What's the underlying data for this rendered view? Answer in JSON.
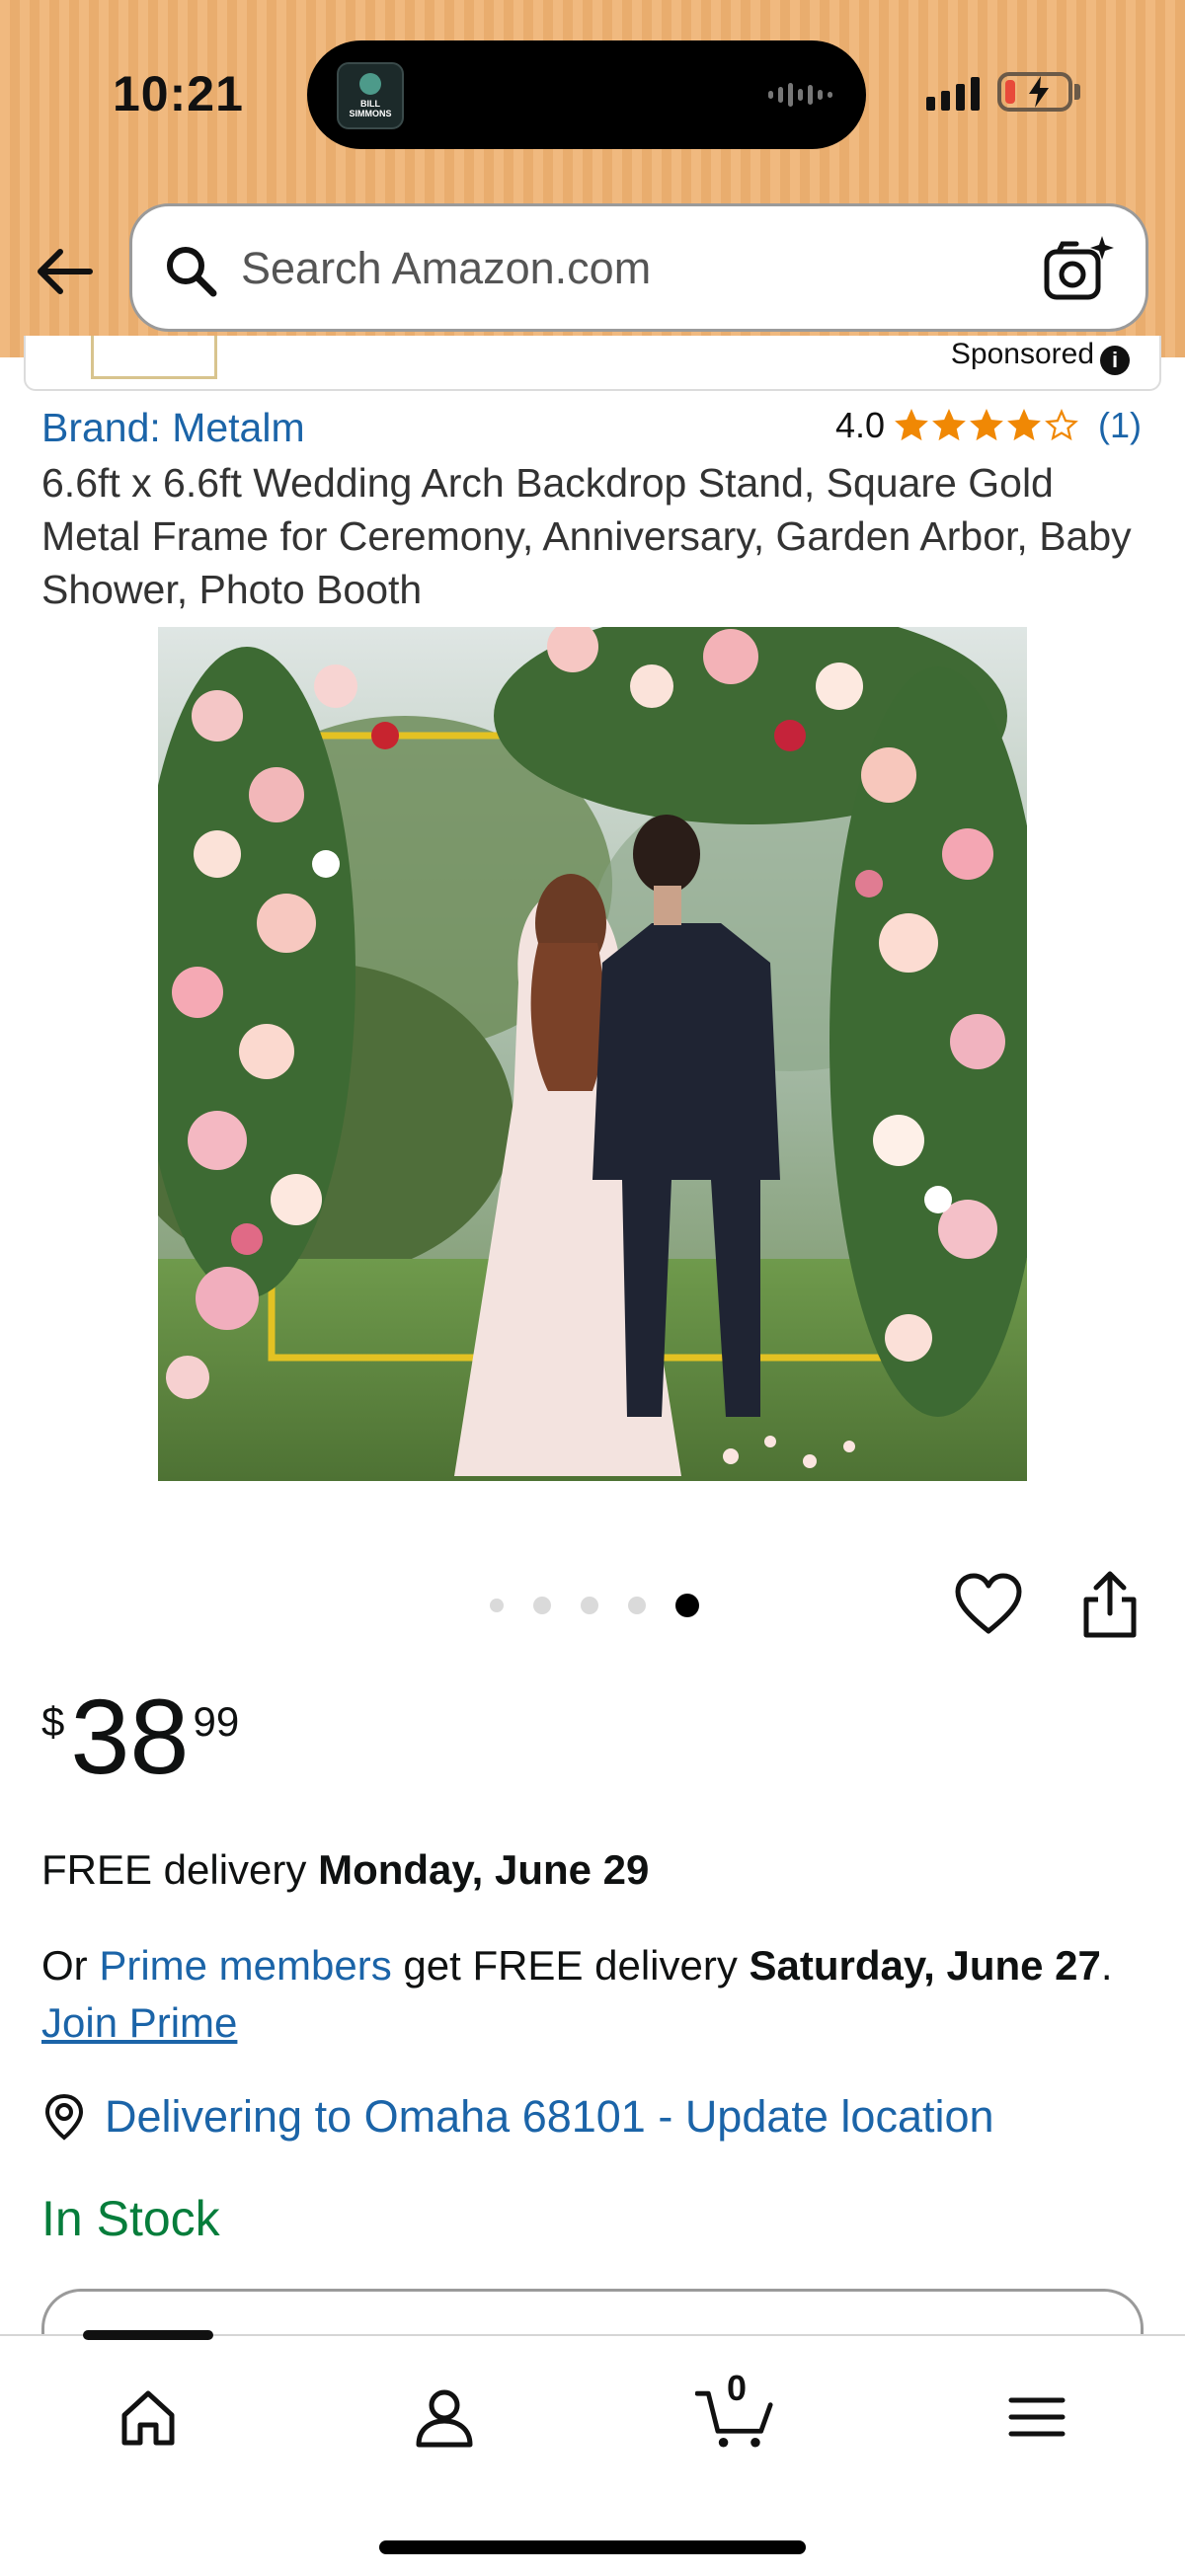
{
  "status_bar": {
    "time": "10:21",
    "now_playing_art_text": "BILL SIMMONS",
    "battery_level": 0.15,
    "battery_color": "#e84a3a",
    "charging": true
  },
  "header": {
    "back_icon": "arrow-left-icon",
    "search": {
      "placeholder": "Search Amazon.com",
      "value": "",
      "icon": "search-icon",
      "camera_icon": "camera-sparkle-icon"
    }
  },
  "sponsored": {
    "label": "Sponsored",
    "info_icon": "i"
  },
  "product": {
    "brand": "Brand: Metalm",
    "rating_value": "4.0",
    "rating_stars": 4,
    "rating_count": "(1)",
    "title": "6.6ft x 6.6ft Wedding Arch Backdrop Stand, Square Gold Metal Frame for Ceremony, Anniversary, Garden Arbor, Baby Shower, Photo Booth",
    "image_count": 5,
    "active_image_index": 4,
    "star_color": "#f08804"
  },
  "price": {
    "symbol": "$",
    "whole": "38",
    "fraction": "99"
  },
  "delivery": {
    "free_prefix": "FREE delivery ",
    "free_date": "Monday, June 29",
    "prime_prefix": "Or ",
    "prime_link": "Prime members",
    "prime_middle": " get FREE delivery ",
    "prime_date": "Saturday, June 27",
    "prime_suffix": ". ",
    "join_prime": "Join Prime",
    "location": "Delivering to Omaha 68101 - Update location",
    "stock": "In Stock"
  },
  "tabbar": {
    "home_icon": "home-icon",
    "account_icon": "user-icon",
    "cart_icon": "cart-icon",
    "cart_count": "0",
    "menu_icon": "menu-icon"
  },
  "colors": {
    "header_bg": "#f0b97f",
    "link": "#1b64a8",
    "in_stock": "#067d3b"
  }
}
